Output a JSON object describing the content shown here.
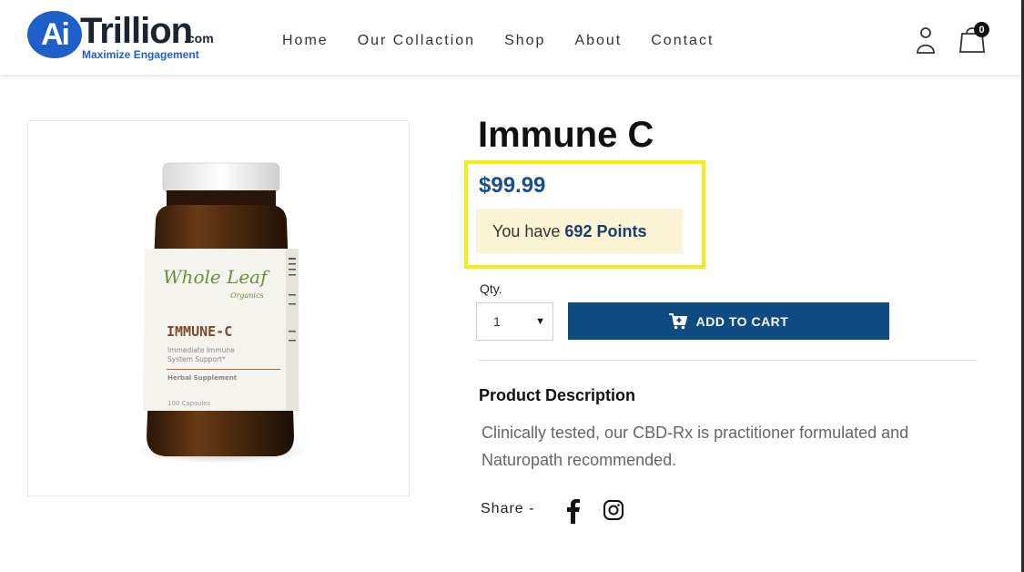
{
  "header": {
    "logo": {
      "mark": "Ai",
      "word": "Trillion",
      "suffix": ".com",
      "tagline": "Maximize Engagement"
    },
    "nav": [
      {
        "label": "Home"
      },
      {
        "label": "Our Collaction"
      },
      {
        "label": "Shop"
      },
      {
        "label": "About"
      },
      {
        "label": "Contact"
      }
    ],
    "cart_count": "0",
    "icons": [
      "user-icon",
      "cart-icon"
    ]
  },
  "product": {
    "title": "Immune C",
    "price": "$99.99",
    "points_prefix": "You have",
    "points_value": "692 Points",
    "qty_label": "Qty.",
    "qty_value": "1",
    "add_to_cart": "ADD TO CART",
    "description_title": "Product Description",
    "description": "Clinically tested, our CBD-Rx is practitioner formulated and Naturopath recommended.",
    "share_label": "Share -",
    "image_label": {
      "brand": "Whole Leaf",
      "brand_sub": "Organics",
      "name": "IMMUNE-C",
      "line1": "Immediate Immune",
      "line2": "System Support*",
      "type": "Herbal Supplement",
      "count": "100 Capsules"
    }
  },
  "colors": {
    "accent": "#104a82",
    "price": "#1a4e8a",
    "highlight": "#f4ec13",
    "points_bg": "#faf3d4",
    "logo_blue": "#1f5fc9"
  }
}
